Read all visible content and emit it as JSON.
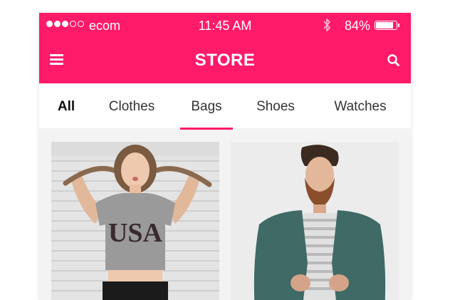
{
  "status_bar": {
    "carrier": "ecom",
    "signal_strength": 3,
    "signal_total": 5,
    "time": "11:45 AM",
    "bluetooth_icon": "bluetooth-icon",
    "battery_percent": "84%",
    "battery_level": 0.84
  },
  "app_bar": {
    "title": "STORE",
    "menu_icon": "hamburger-menu-icon",
    "search_icon": "search-icon"
  },
  "tabs": [
    {
      "label": "All"
    },
    {
      "label": "Clothes"
    },
    {
      "label": "Bags"
    },
    {
      "label": "Shoes"
    },
    {
      "label": "Watches"
    }
  ],
  "active_tab": "Bags",
  "products": [
    {
      "image": "product-photo-usa-tshirt"
    },
    {
      "image": "product-photo-green-jacket"
    }
  ],
  "colors": {
    "accent": "#ff1a6a",
    "background": "#f3f3f3",
    "surface": "#ffffff",
    "text": "#333333"
  }
}
